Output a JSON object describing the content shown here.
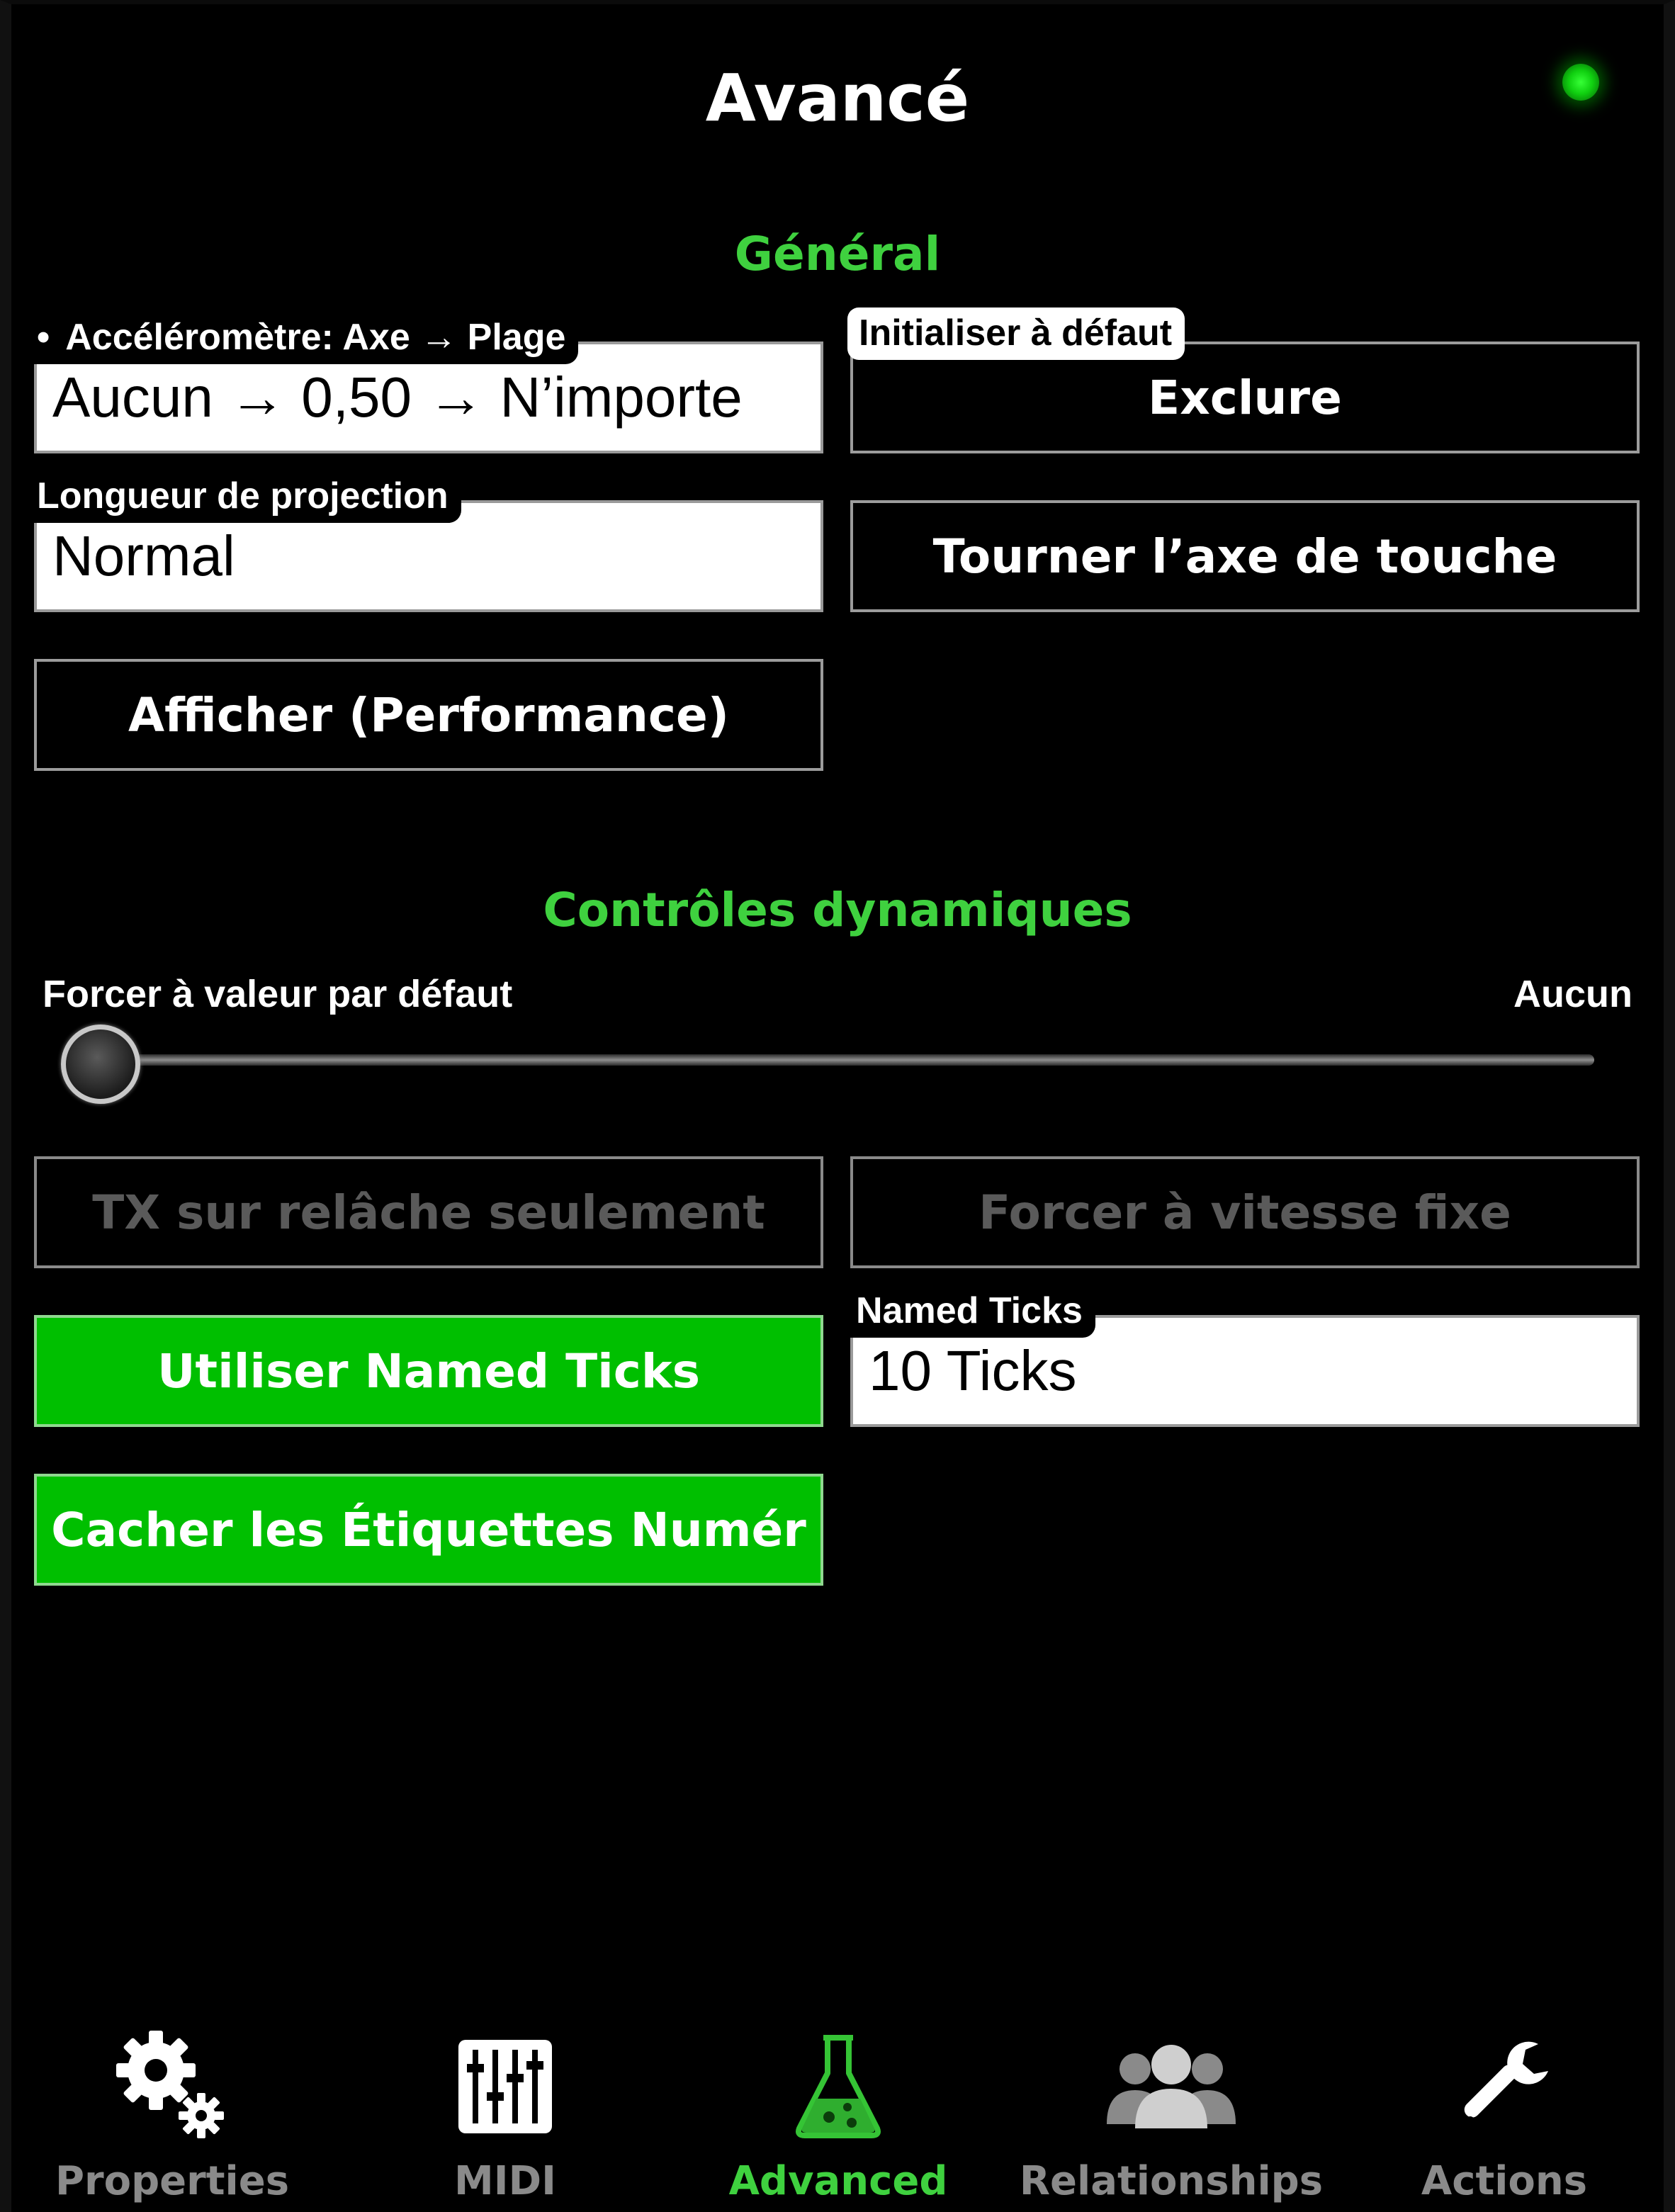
{
  "header": {
    "title": "Avancé",
    "status_color": "#22ee22"
  },
  "general": {
    "section_title": "Général",
    "accel_label": "Accéléromètre: Axe → Plage",
    "accel_value": "Aucun → 0,50 → N’importe",
    "init_label": "Initialiser à défaut",
    "init_button": "Exclure",
    "projection_label": "Longueur de projection",
    "projection_value": "Normal",
    "rotate_button": "Tourner l’axe de touche",
    "display_button": "Afficher (Performance)"
  },
  "dynamic": {
    "section_title": "Contrôles dynamiques",
    "slider_label": "Forcer à valeur par défaut",
    "slider_value": "Aucun",
    "slider_fraction": 0,
    "tx_button": "TX sur relâche seulement",
    "speed_button": "Forcer à vitesse fixe",
    "named_ticks_button": "Utiliser Named Ticks",
    "named_ticks_label": "Named Ticks",
    "named_ticks_value": "10 Ticks",
    "hide_labels_button": "Cacher les Étiquettes Numér"
  },
  "tabs": [
    {
      "label": "Properties",
      "icon": "gears-icon",
      "active": false
    },
    {
      "label": "MIDI",
      "icon": "mixer-sliders-icon",
      "active": false
    },
    {
      "label": "Advanced",
      "icon": "flask-icon",
      "active": true
    },
    {
      "label": "Relationships",
      "icon": "people-icon",
      "active": false
    },
    {
      "label": "Actions",
      "icon": "wrench-icon",
      "active": false
    }
  ],
  "colors": {
    "accent": "#3fd13f",
    "button_green": "#00bf00",
    "background": "#000000"
  }
}
